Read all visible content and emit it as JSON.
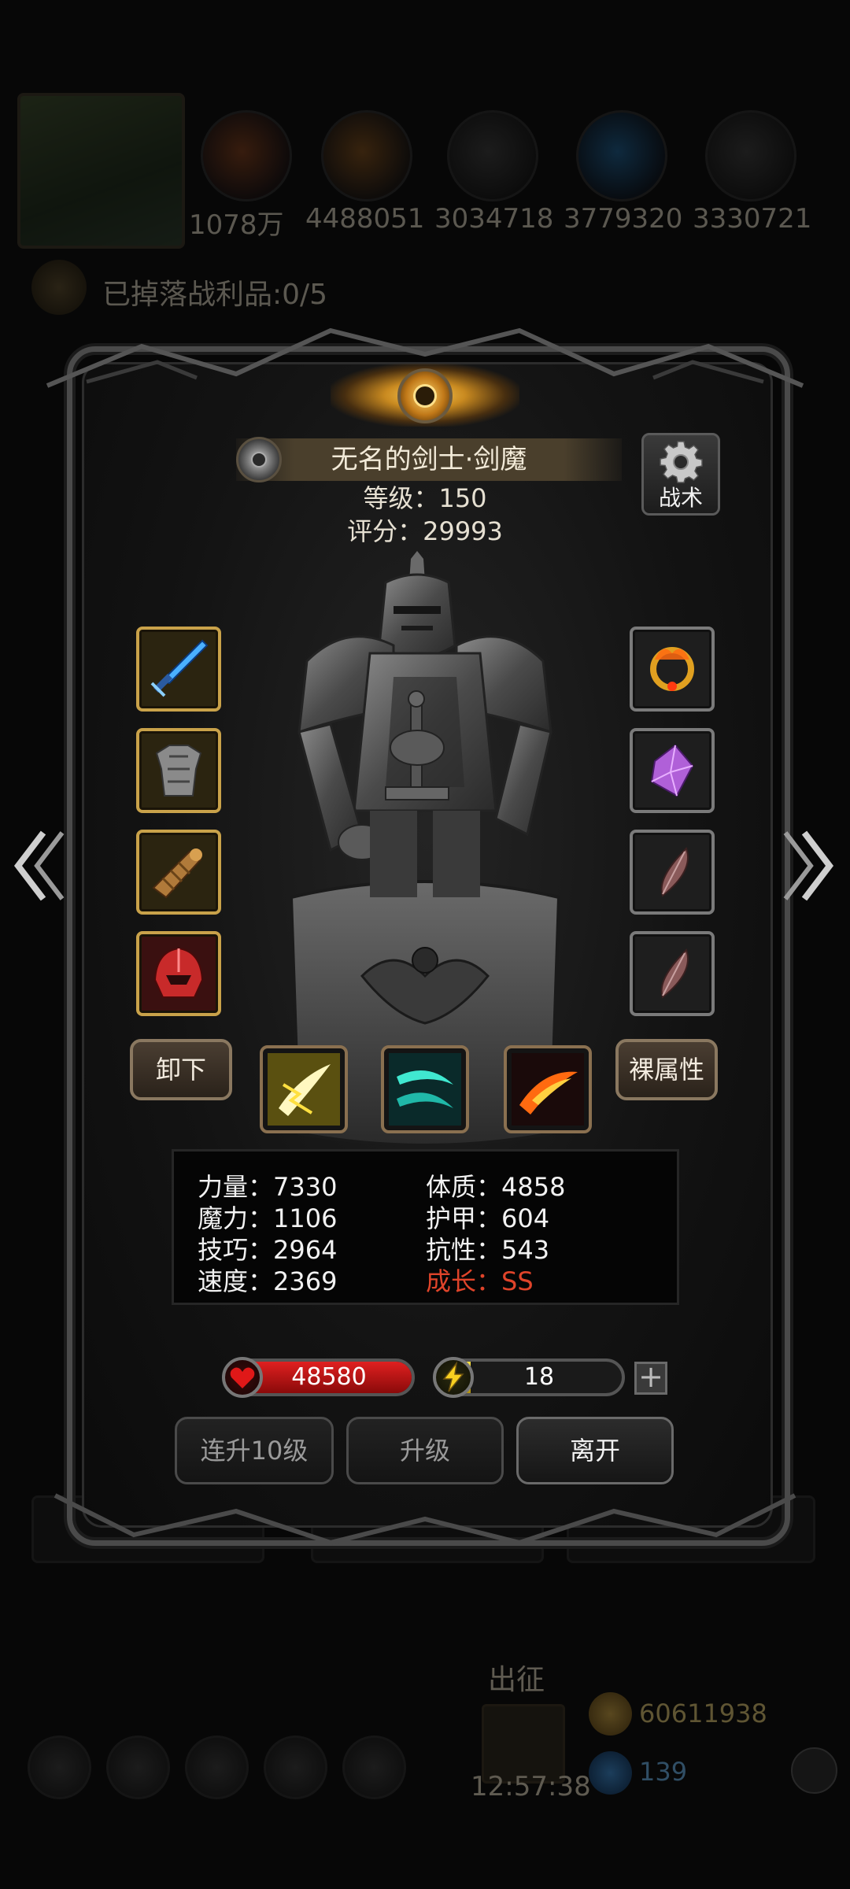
{
  "background": {
    "resources": [
      "1078万",
      "4488051",
      "3034718",
      "3779320",
      "3330721"
    ],
    "loot_text": "已掉落战利品:0/5",
    "expedition_label": "出征",
    "timer": "12:57:38",
    "gold": "60611938",
    "gems": "139"
  },
  "hero": {
    "name": "无名的剑士·剑魔",
    "level_text": "等级：150",
    "score_text": "评分：29993"
  },
  "tactics_label": "战术",
  "buttons": {
    "unequip": "卸下",
    "base_attributes": "裸属性",
    "level_up_10": "连升10级",
    "level_up": "升级",
    "leave": "离开"
  },
  "equipment": {
    "left": [
      "blue-sword-icon",
      "steel-armor-icon",
      "gauntlet-icon",
      "red-helmet-icon"
    ],
    "right": [
      "fire-ring-icon",
      "purple-crystal-icon",
      "feather-icon",
      "feather-icon"
    ]
  },
  "skills": [
    "lightning-slash-icon",
    "wind-slash-icon",
    "fire-slash-icon"
  ],
  "stats": {
    "strength": "力量：7330",
    "magic": "魔力：1106",
    "skill": "技巧：2964",
    "speed": "速度：2369",
    "constitution": "体质：4858",
    "armor": "护甲：604",
    "resistance": "抗性：543",
    "growth": "成长：SS"
  },
  "hp": {
    "value": "48580",
    "fill": 1.0
  },
  "energy": {
    "value": "18",
    "fill": 0.18
  },
  "colors": {
    "growth": "#e0442a",
    "hp": "#c81818",
    "energy": "#e8c820",
    "gold_border": "#c9a24a"
  }
}
